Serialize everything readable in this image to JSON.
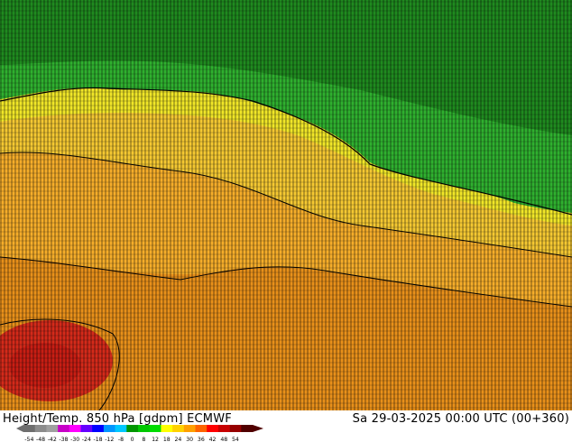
{
  "footer": {
    "title": "Height/Temp. 850 hPa [gdpm] ECMWF",
    "datetime": "Sa 29-03-2025 00:00 UTC (00+360)"
  },
  "legend": {
    "ticks": [
      "-54",
      "-48",
      "-42",
      "-38",
      "-30",
      "-24",
      "-18",
      "-12",
      "-8",
      "0",
      "8",
      "12",
      "18",
      "24",
      "30",
      "36",
      "42",
      "48",
      "54"
    ],
    "colors": [
      "#6e6e6e",
      "#8c8c8c",
      "#a0a0a0",
      "#c800c8",
      "#ff00ff",
      "#6400ff",
      "#0000ff",
      "#0096ff",
      "#00c8ff",
      "#009600",
      "#00c800",
      "#00dc00",
      "#ffff00",
      "#ffd200",
      "#ffa000",
      "#ff6400",
      "#ff0000",
      "#c80000",
      "#960000",
      "#500000"
    ]
  },
  "map": {
    "colors": {
      "green_dark": "#1e7d1e",
      "green": "#2db42d",
      "green_light": "#41c841",
      "yellow": "#f0e626",
      "yellow_orange": "#f5c828",
      "orange": "#f5a01e",
      "orange_dark": "#e68214",
      "red": "#d21e1e",
      "contour": "#000000"
    }
  }
}
